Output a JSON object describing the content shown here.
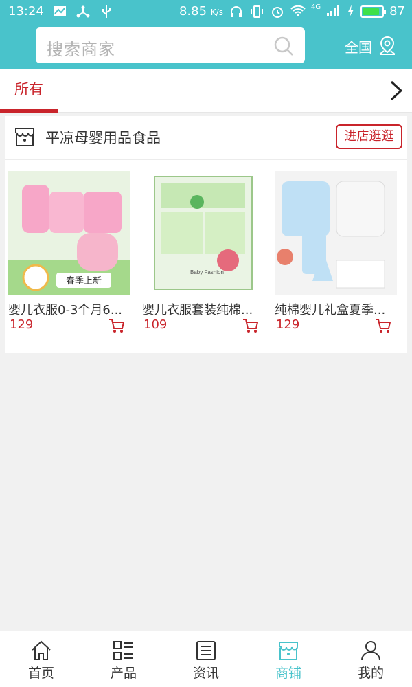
{
  "status_bar": {
    "time": "13:24",
    "speed": "8.85",
    "speed_unit": "K/s",
    "network": "4G",
    "battery": "87",
    "battery_level": 0.87
  },
  "header": {
    "search_placeholder": "搜索商家",
    "region_label": "全国",
    "accent_color": "#49c3cb"
  },
  "tabs": {
    "active_label": "所有",
    "active_color": "#c9242b"
  },
  "store": {
    "name": "平凉母婴用品食品",
    "visit_label": "进店逛逛",
    "products": [
      {
        "title": "婴儿衣服0-3个月6...",
        "price": "129",
        "image": "pink baby clothes gift set",
        "badge": "春季上新"
      },
      {
        "title": "婴儿衣服套装纯棉...",
        "price": "109",
        "image": "green baby clothes gift box",
        "badge": "Baby Fashion"
      },
      {
        "title": "纯棉婴儿礼盒夏季...",
        "price": "129",
        "image": "blue baby clothes gift set"
      }
    ]
  },
  "bottom_nav": [
    {
      "label": "首页",
      "icon": "home-icon",
      "active": false
    },
    {
      "label": "产品",
      "icon": "product-list-icon",
      "active": false
    },
    {
      "label": "资讯",
      "icon": "news-icon",
      "active": false
    },
    {
      "label": "商铺",
      "icon": "store-icon",
      "active": true
    },
    {
      "label": "我的",
      "icon": "user-icon",
      "active": false
    }
  ]
}
